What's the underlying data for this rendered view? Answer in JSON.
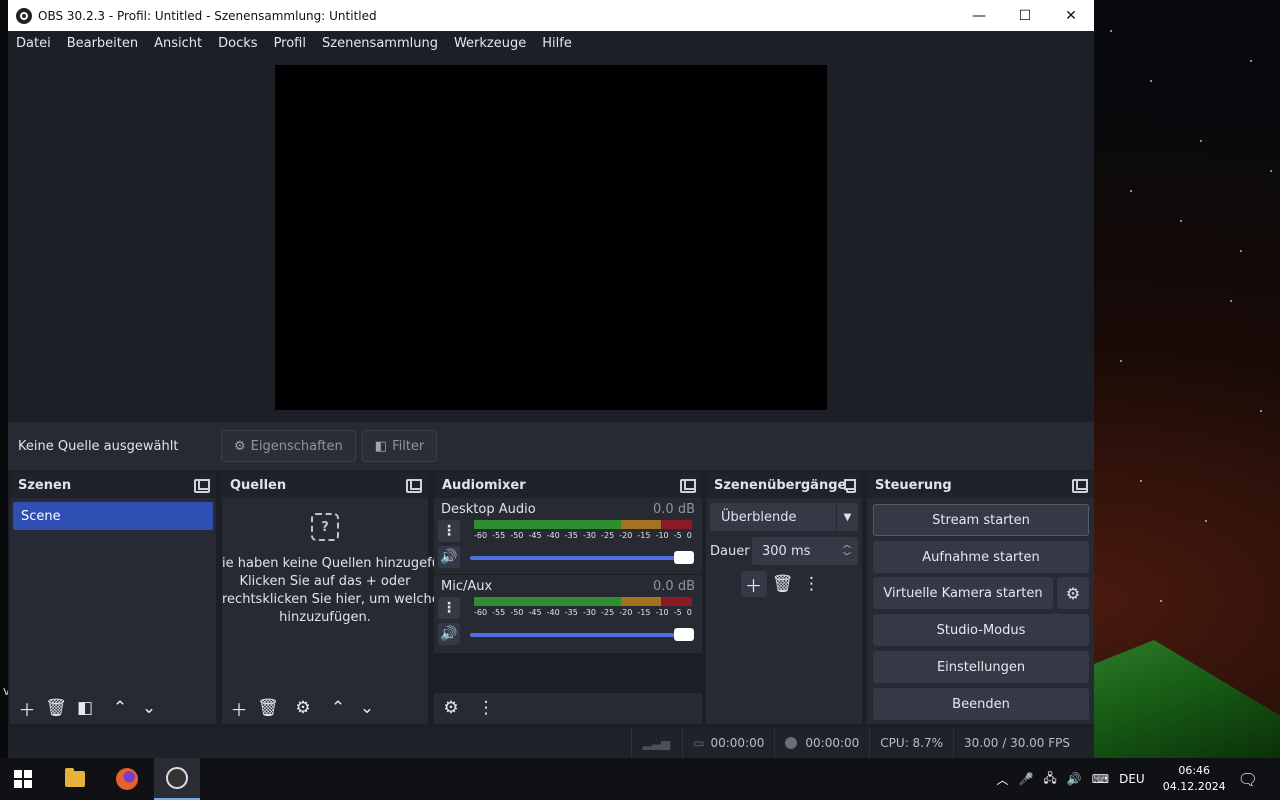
{
  "window": {
    "title": "OBS 30.2.3 - Profil: Untitled - Szenensammlung: Untitled",
    "controls": {
      "minimize": "—",
      "maximize": "☐",
      "close": "✕"
    }
  },
  "menu": [
    "Datei",
    "Bearbeiten",
    "Ansicht",
    "Docks",
    "Profil",
    "Szenensammlung",
    "Werkzeuge",
    "Hilfe"
  ],
  "source_toolbar": {
    "status": "Keine Quelle ausgewählt",
    "properties": "Eigenschaften",
    "filters": "Filter"
  },
  "scenes": {
    "title": "Szenen",
    "items": [
      "Scene"
    ]
  },
  "sources": {
    "title": "Quellen",
    "empty_lines": [
      "ie haben keine Quellen hinzugefüg",
      "Klicken Sie auf das + oder",
      "rechtsklicken Sie hier, um welche",
      "hinzuzufügen."
    ]
  },
  "mixer": {
    "title": "Audiomixer",
    "channels": [
      {
        "name": "Desktop Audio",
        "db": "0.0 dB",
        "volume": 1.0
      },
      {
        "name": "Mic/Aux",
        "db": "0.0 dB",
        "volume": 1.0
      }
    ],
    "ticks": [
      "-60",
      "-55",
      "-50",
      "-45",
      "-40",
      "-35",
      "-30",
      "-25",
      "-20",
      "-15",
      "-10",
      "-5",
      "0"
    ]
  },
  "transitions": {
    "title": "Szenenübergänge",
    "selected": "Überblende",
    "duration_label": "Dauer",
    "duration_value": "300 ms"
  },
  "controls": {
    "title": "Steuerung",
    "stream": "Stream starten",
    "record": "Aufnahme starten",
    "virtual_cam": "Virtuelle Kamera starten",
    "studio": "Studio-Modus",
    "settings": "Einstellungen",
    "exit": "Beenden"
  },
  "status": {
    "stream_time": "00:00:00",
    "record_time": "00:00:00",
    "cpu": "CPU: 8.7%",
    "fps": "30.00 / 30.00 FPS"
  },
  "taskbar": {
    "language": "DEU",
    "time": "06:46",
    "date": "04.12.2024"
  },
  "colors": {
    "accent": "#2f4fb5",
    "meter_green": "#2f8e2f",
    "meter_yellow": "#a27421",
    "meter_red": "#8c1a26"
  }
}
